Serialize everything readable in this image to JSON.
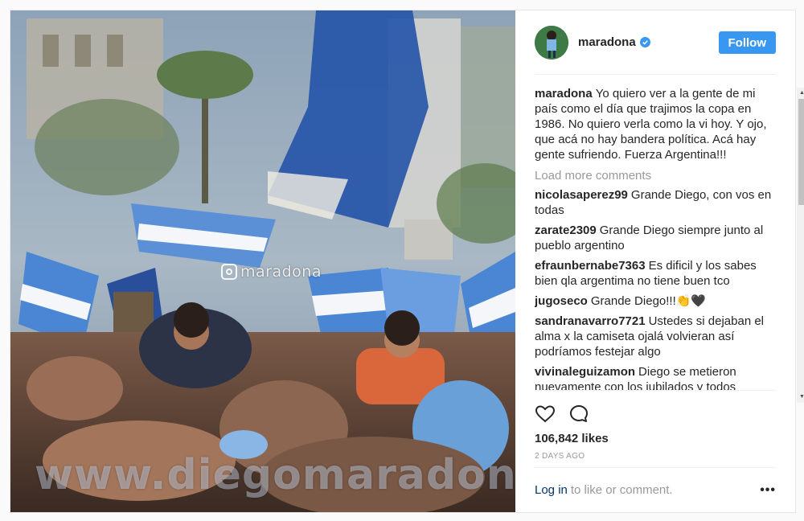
{
  "post": {
    "author": "maradona",
    "follow_label": "Follow",
    "caption": "Yo quiero ver a la gente de mi país como el día que trajimos la copa en 1986. No quiero verla como la vi hoy. Y ojo, que acá no hay bandera política. Acá hay gente sufriendo. Fuerza Argentina!!!",
    "load_more": "Load more comments",
    "comments": [
      {
        "user": "nicolasaperez99",
        "text": "Grande Diego, con vos en todas"
      },
      {
        "user": "zarate2309",
        "text": "Grande Diego siempre junto al pueblo argentino"
      },
      {
        "user": "efraunbernabe7363",
        "text": "Es dificil y los sabes bien qla argentima no tiene buen tco"
      },
      {
        "user": "jugoseco",
        "text": "Grande Diego!!!👏🖤"
      },
      {
        "user": "sandranavarro7721",
        "text": "Ustedes si dejaban el alma x la camiseta ojalá volvieran así podríamos festejar algo"
      },
      {
        "user": "vivinaleguizamon",
        "text": "Diego se metieron nuevamente con los jubilados y todos"
      }
    ],
    "likes": "106,842 likes",
    "time": "2 DAYS AGO",
    "login_link": "Log in",
    "login_rest": "to like or comment.",
    "more_glyph": "•••"
  },
  "photo": {
    "watermark_handle": "maradona",
    "watermark_site": "www.diegomaradona.com"
  },
  "colors": {
    "follow_bg": "#3897f0",
    "text": "#262626",
    "muted": "#999999",
    "link": "#003569"
  }
}
